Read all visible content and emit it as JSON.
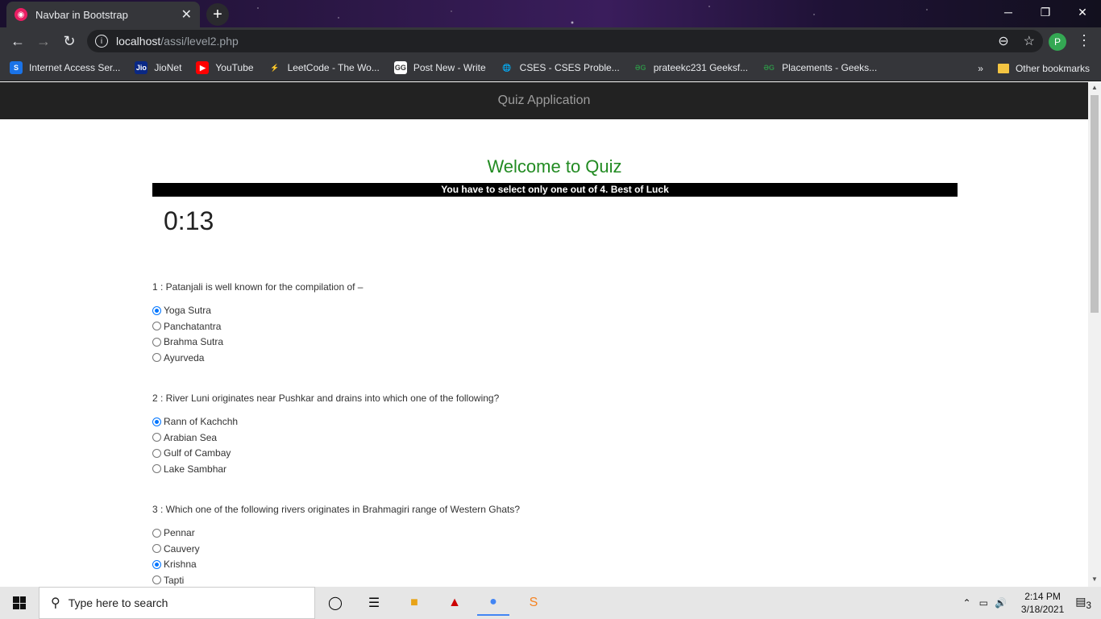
{
  "browser": {
    "tab_title": "Navbar in Bootstrap",
    "url_host": "localhost",
    "url_path": "/assi/level2.php",
    "profile_initial": "P",
    "bookmarks": [
      {
        "label": "Internet Access Ser...",
        "icon": "s-icon",
        "color": "#1a73e8",
        "glyph": "S"
      },
      {
        "label": "JioNet",
        "icon": "jio-icon",
        "color": "#0a2885",
        "glyph": "Jio"
      },
      {
        "label": "YouTube",
        "icon": "youtube-icon",
        "color": "#ff0000",
        "glyph": "▶"
      },
      {
        "label": "LeetCode - The Wo...",
        "icon": "leetcode-icon",
        "color": "#35363a",
        "glyph": "⚡"
      },
      {
        "label": "Post New - Write",
        "icon": "gfg-icon",
        "color": "#ffffff",
        "glyph": "GG"
      },
      {
        "label": "CSES - CSES Proble...",
        "icon": "globe-icon",
        "color": "#35363a",
        "glyph": "🌐"
      },
      {
        "label": "prateekc231 Geeksf...",
        "icon": "gfg-green-icon",
        "color": "#35363a",
        "glyph": "ƏG"
      },
      {
        "label": "Placements - Geeks...",
        "icon": "gfg-green-icon",
        "color": "#35363a",
        "glyph": "ƏG"
      }
    ],
    "other_bookmarks": "Other bookmarks"
  },
  "page": {
    "navbar_title": "Quiz Application",
    "welcome": "Welcome to Quiz",
    "notice": "You have to select only one out of 4. Best of Luck",
    "timer": "0:13",
    "questions": [
      {
        "text": "1 : Patanjali is well known for the compilation of –",
        "options": [
          "Yoga Sutra",
          "Panchatantra",
          "Brahma Sutra",
          "Ayurveda"
        ],
        "selected": 0
      },
      {
        "text": "2 : River Luni originates near Pushkar and drains into which one of the following?",
        "options": [
          "Rann of Kachchh",
          "Arabian Sea",
          "Gulf of Cambay",
          "Lake Sambhar"
        ],
        "selected": 0
      },
      {
        "text": "3 : Which one of the following rivers originates in Brahmagiri range of Western Ghats?",
        "options": [
          "Pennar",
          "Cauvery",
          "Krishna",
          "Tapti"
        ],
        "selected": 2
      }
    ]
  },
  "taskbar": {
    "search_placeholder": "Type here to search",
    "time": "2:14 PM",
    "date": "3/18/2021",
    "notifications": "3"
  }
}
